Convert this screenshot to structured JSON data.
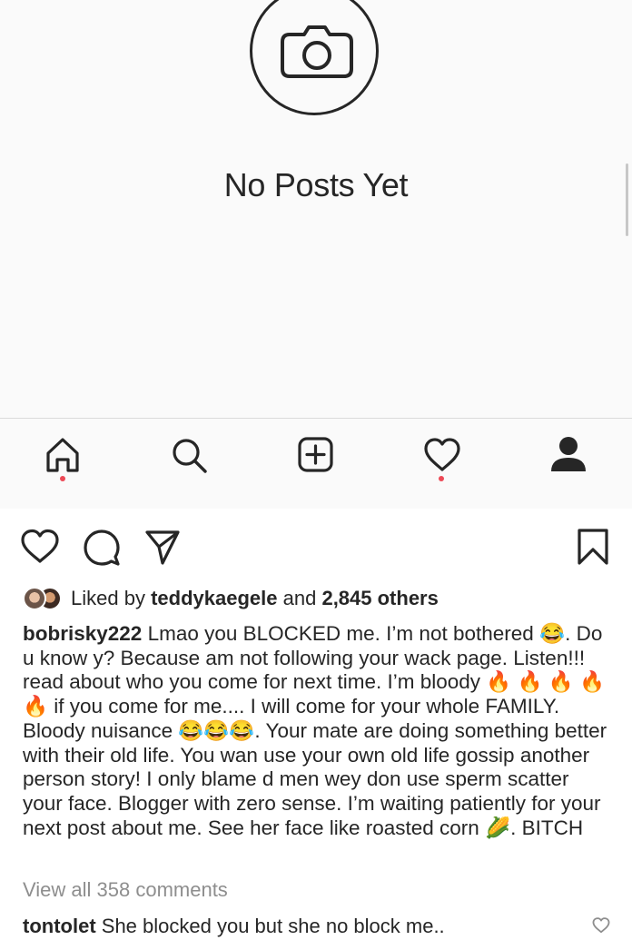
{
  "profile": {
    "empty_state_text": "No Posts Yet"
  },
  "tabbar": {
    "items": [
      {
        "name": "home",
        "icon": "home-icon",
        "has_notification": true
      },
      {
        "name": "search",
        "icon": "search-icon",
        "has_notification": false
      },
      {
        "name": "new-post",
        "icon": "plus-square-icon",
        "has_notification": false
      },
      {
        "name": "activity",
        "icon": "heart-icon",
        "has_notification": true
      },
      {
        "name": "profile",
        "icon": "person-icon",
        "has_notification": false
      }
    ],
    "notification_color": "#ed4956"
  },
  "post": {
    "actions": [
      "heart-icon",
      "comment-icon",
      "share-icon",
      "bookmark-icon"
    ],
    "likes": {
      "prefix": "Liked by",
      "user": "teddykaegele",
      "middle": "and",
      "count_text": "2,845 others"
    },
    "caption": {
      "username": "bobrisky222",
      "parts": [
        " Lmao you BLOCKED me. I’m not bothered ",
        "😂",
        ". Do u know y? Because am not following your wack page. Listen!!! read about who you come for next time. I’m bloody ",
        "🔥 🔥 🔥 🔥 🔥",
        " if you come for me.... I will come for your whole FAMILY. Bloody nuisance ",
        "😂😂😂",
        ". Your mate are doing something better with their old life. You wan use your own old life gossip another person story! I only blame d men wey don use sperm scatter your face. Blogger with zero sense. I’m waiting patiently for your next post about me. See her face like roasted corn ",
        "🌽",
        ". BITCH"
      ]
    },
    "view_comments": "View all 358 comments",
    "comment": {
      "username": "tontolet",
      "text": " She blocked you but she no block me.."
    }
  }
}
